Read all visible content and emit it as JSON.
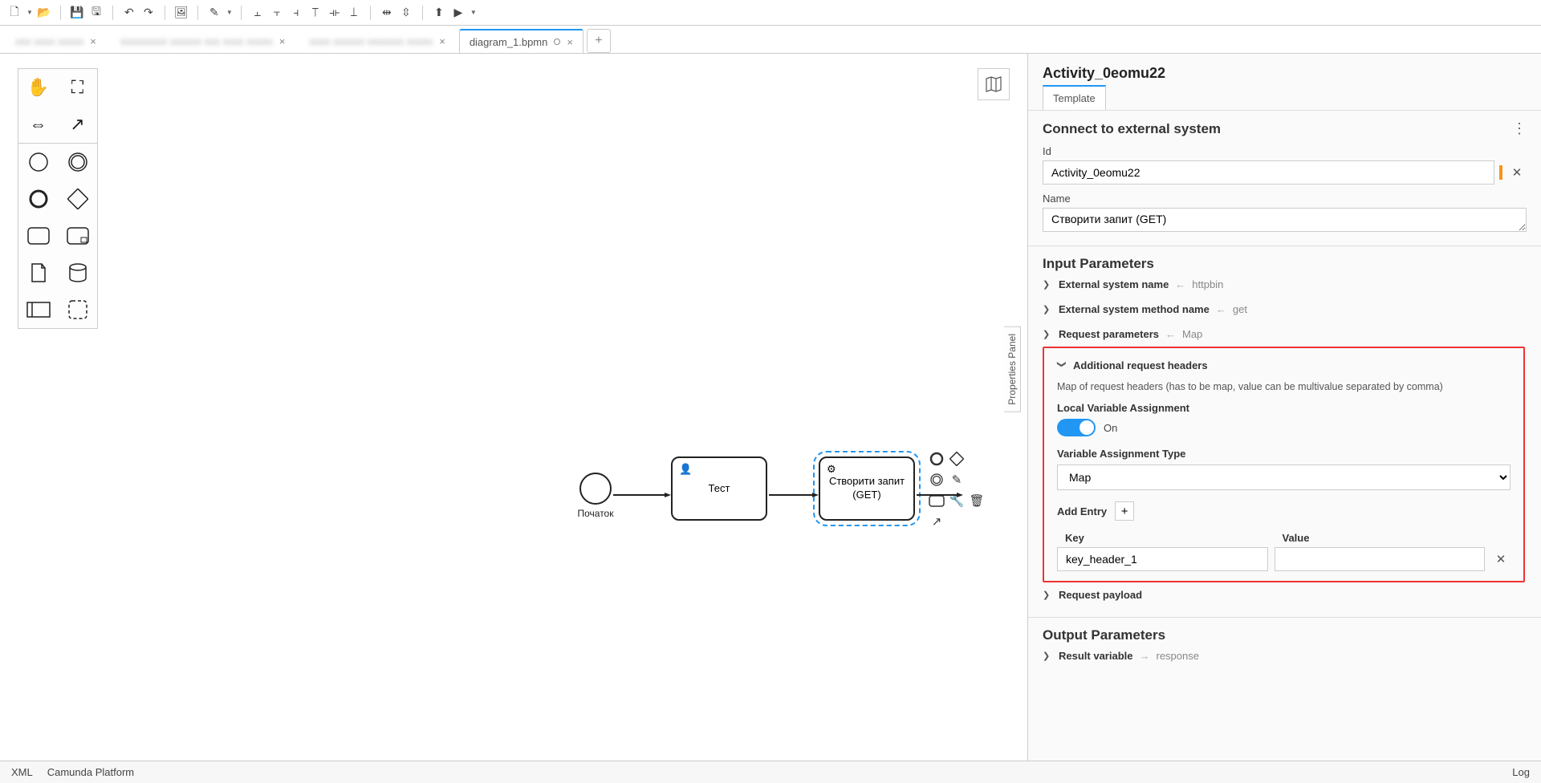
{
  "toolbar": {
    "icons": [
      "new-file",
      "open",
      "save",
      "save-all",
      "undo",
      "redo",
      "image",
      "highlight",
      "align-left",
      "align-center",
      "align-right",
      "dist-h1",
      "dist-h2",
      "dist-h3",
      "dist-v1",
      "dist-v2",
      "upload",
      "play"
    ]
  },
  "tabs": {
    "inactive": [
      "tab-1",
      "tab-2",
      "tab-3"
    ],
    "active_label": "diagram_1.bpmn",
    "add": "+"
  },
  "palette": {
    "tools": [
      "hand",
      "lasso",
      "space",
      "connect"
    ],
    "shapes": [
      "start-event",
      "int-event",
      "end-event",
      "gateway",
      "task",
      "subprocess",
      "data-object",
      "data-store",
      "participant",
      "group"
    ]
  },
  "minimap_label": "🗺",
  "vpanel_label": "Properties Panel",
  "diagram": {
    "start_label": "Початок",
    "task1_label": "Тест",
    "task2_line1": "Створити запит",
    "task2_line2": "(GET)"
  },
  "props": {
    "title": "Activity_0eomu22",
    "tab_template": "Template",
    "sec_connect": "Connect to external system",
    "id_label": "Id",
    "id_value": "Activity_0eomu22",
    "name_label": "Name",
    "name_value": "Створити запит (GET)",
    "sec_input": "Input Parameters",
    "p_ext_name": "External system name",
    "v_ext_name": "httpbin",
    "p_ext_method": "External system method name",
    "v_ext_method": "get",
    "p_req_params": "Request parameters",
    "v_req_params": "Map",
    "p_headers": "Additional request headers",
    "headers_desc": "Map of request headers (has to be map, value can be multivalue separated by comma)",
    "lva_label": "Local Variable Assignment",
    "lva_on": "On",
    "vat_label": "Variable Assignment Type",
    "vat_value": "Map",
    "add_entry": "Add Entry",
    "col_key": "Key",
    "col_value": "Value",
    "entry_key": "key_header_1",
    "entry_value": "",
    "p_payload": "Request payload",
    "sec_output": "Output Parameters",
    "p_result": "Result variable",
    "v_result": "response"
  },
  "status": {
    "xml": "XML",
    "platform": "Camunda Platform",
    "log": "Log"
  }
}
